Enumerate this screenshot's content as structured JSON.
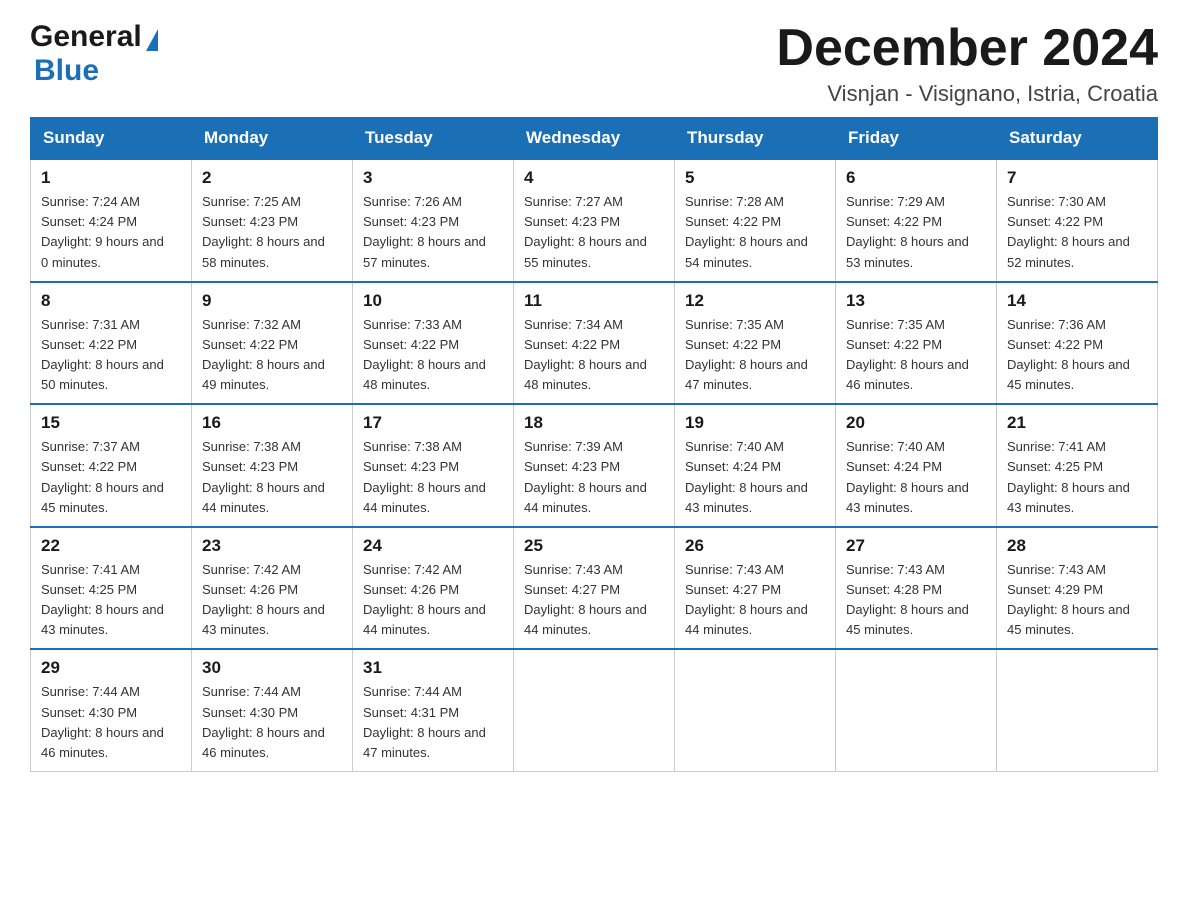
{
  "header": {
    "logo_general": "General",
    "logo_blue": "Blue",
    "month_title": "December 2024",
    "location": "Visnjan - Visignano, Istria, Croatia"
  },
  "calendar": {
    "days_of_week": [
      "Sunday",
      "Monday",
      "Tuesday",
      "Wednesday",
      "Thursday",
      "Friday",
      "Saturday"
    ],
    "weeks": [
      [
        {
          "day": "1",
          "sunrise": "7:24 AM",
          "sunset": "4:24 PM",
          "daylight": "9 hours and 0 minutes."
        },
        {
          "day": "2",
          "sunrise": "7:25 AM",
          "sunset": "4:23 PM",
          "daylight": "8 hours and 58 minutes."
        },
        {
          "day": "3",
          "sunrise": "7:26 AM",
          "sunset": "4:23 PM",
          "daylight": "8 hours and 57 minutes."
        },
        {
          "day": "4",
          "sunrise": "7:27 AM",
          "sunset": "4:23 PM",
          "daylight": "8 hours and 55 minutes."
        },
        {
          "day": "5",
          "sunrise": "7:28 AM",
          "sunset": "4:22 PM",
          "daylight": "8 hours and 54 minutes."
        },
        {
          "day": "6",
          "sunrise": "7:29 AM",
          "sunset": "4:22 PM",
          "daylight": "8 hours and 53 minutes."
        },
        {
          "day": "7",
          "sunrise": "7:30 AM",
          "sunset": "4:22 PM",
          "daylight": "8 hours and 52 minutes."
        }
      ],
      [
        {
          "day": "8",
          "sunrise": "7:31 AM",
          "sunset": "4:22 PM",
          "daylight": "8 hours and 50 minutes."
        },
        {
          "day": "9",
          "sunrise": "7:32 AM",
          "sunset": "4:22 PM",
          "daylight": "8 hours and 49 minutes."
        },
        {
          "day": "10",
          "sunrise": "7:33 AM",
          "sunset": "4:22 PM",
          "daylight": "8 hours and 48 minutes."
        },
        {
          "day": "11",
          "sunrise": "7:34 AM",
          "sunset": "4:22 PM",
          "daylight": "8 hours and 48 minutes."
        },
        {
          "day": "12",
          "sunrise": "7:35 AM",
          "sunset": "4:22 PM",
          "daylight": "8 hours and 47 minutes."
        },
        {
          "day": "13",
          "sunrise": "7:35 AM",
          "sunset": "4:22 PM",
          "daylight": "8 hours and 46 minutes."
        },
        {
          "day": "14",
          "sunrise": "7:36 AM",
          "sunset": "4:22 PM",
          "daylight": "8 hours and 45 minutes."
        }
      ],
      [
        {
          "day": "15",
          "sunrise": "7:37 AM",
          "sunset": "4:22 PM",
          "daylight": "8 hours and 45 minutes."
        },
        {
          "day": "16",
          "sunrise": "7:38 AM",
          "sunset": "4:23 PM",
          "daylight": "8 hours and 44 minutes."
        },
        {
          "day": "17",
          "sunrise": "7:38 AM",
          "sunset": "4:23 PM",
          "daylight": "8 hours and 44 minutes."
        },
        {
          "day": "18",
          "sunrise": "7:39 AM",
          "sunset": "4:23 PM",
          "daylight": "8 hours and 44 minutes."
        },
        {
          "day": "19",
          "sunrise": "7:40 AM",
          "sunset": "4:24 PM",
          "daylight": "8 hours and 43 minutes."
        },
        {
          "day": "20",
          "sunrise": "7:40 AM",
          "sunset": "4:24 PM",
          "daylight": "8 hours and 43 minutes."
        },
        {
          "day": "21",
          "sunrise": "7:41 AM",
          "sunset": "4:25 PM",
          "daylight": "8 hours and 43 minutes."
        }
      ],
      [
        {
          "day": "22",
          "sunrise": "7:41 AM",
          "sunset": "4:25 PM",
          "daylight": "8 hours and 43 minutes."
        },
        {
          "day": "23",
          "sunrise": "7:42 AM",
          "sunset": "4:26 PM",
          "daylight": "8 hours and 43 minutes."
        },
        {
          "day": "24",
          "sunrise": "7:42 AM",
          "sunset": "4:26 PM",
          "daylight": "8 hours and 44 minutes."
        },
        {
          "day": "25",
          "sunrise": "7:43 AM",
          "sunset": "4:27 PM",
          "daylight": "8 hours and 44 minutes."
        },
        {
          "day": "26",
          "sunrise": "7:43 AM",
          "sunset": "4:27 PM",
          "daylight": "8 hours and 44 minutes."
        },
        {
          "day": "27",
          "sunrise": "7:43 AM",
          "sunset": "4:28 PM",
          "daylight": "8 hours and 45 minutes."
        },
        {
          "day": "28",
          "sunrise": "7:43 AM",
          "sunset": "4:29 PM",
          "daylight": "8 hours and 45 minutes."
        }
      ],
      [
        {
          "day": "29",
          "sunrise": "7:44 AM",
          "sunset": "4:30 PM",
          "daylight": "8 hours and 46 minutes."
        },
        {
          "day": "30",
          "sunrise": "7:44 AM",
          "sunset": "4:30 PM",
          "daylight": "8 hours and 46 minutes."
        },
        {
          "day": "31",
          "sunrise": "7:44 AM",
          "sunset": "4:31 PM",
          "daylight": "8 hours and 47 minutes."
        },
        null,
        null,
        null,
        null
      ]
    ]
  }
}
